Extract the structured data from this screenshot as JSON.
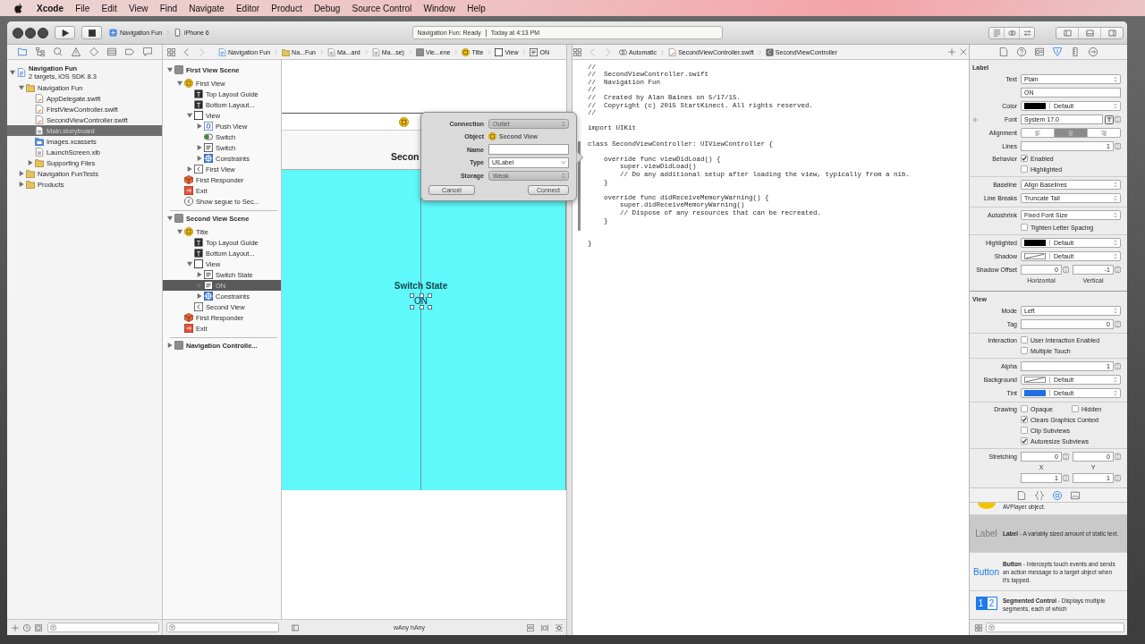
{
  "menu_bar": {
    "app_name": "Xcode",
    "menus": [
      "File",
      "Edit",
      "View",
      "Find",
      "Navigate",
      "Editor",
      "Product",
      "Debug",
      "Source Control",
      "Window",
      "Help"
    ]
  },
  "toolbar": {
    "scheme": "Navigation Fun",
    "device": "iPhone 6",
    "status": "Navigation Fun: Ready",
    "time": "Today at 4:13 PM"
  },
  "navigator": {
    "tabs": [
      {
        "selected": true
      },
      {
        "selected": false
      },
      {
        "selected": false
      },
      {
        "selected": false
      },
      {
        "selected": false
      },
      {
        "selected": false
      },
      {
        "selected": false
      },
      {
        "selected": false
      }
    ],
    "items": [
      {
        "name": "Navigation Fun",
        "subtitle": "2 targets, iOS SDK 8.3",
        "kind": "project",
        "expanded": true,
        "selected": false,
        "children": [
          {
            "name": "Navigation Fun",
            "kind": "folder",
            "expanded": true,
            "selected": false,
            "children": [
              {
                "name": "AppDelegate.swift",
                "kind": "swift",
                "selected": false
              },
              {
                "name": "FirstViewController.swift",
                "kind": "swift",
                "selected": false
              },
              {
                "name": "SecondViewController.swift",
                "kind": "swift",
                "selected": false
              },
              {
                "name": "Main.storyboard",
                "kind": "storyboard",
                "selected": true
              },
              {
                "name": "Images.xcassets",
                "kind": "assets",
                "selected": false
              },
              {
                "name": "LaunchScreen.xib",
                "kind": "xib",
                "selected": false
              },
              {
                "name": "Supporting Files",
                "kind": "folder",
                "expanded": false,
                "selected": false
              }
            ]
          },
          {
            "name": "Navigation FunTests",
            "kind": "folder",
            "expanded": false,
            "selected": false
          },
          {
            "name": "Products",
            "kind": "folder",
            "expanded": false,
            "selected": false
          }
        ]
      }
    ]
  },
  "jump_bar": {
    "crumbs": [
      {
        "label": "Navigation Fun",
        "kind": "project"
      },
      {
        "label": "Na...Fun",
        "kind": "folder"
      },
      {
        "label": "Ma...ard",
        "kind": "storyboard"
      },
      {
        "label": "Ma...se)",
        "kind": "storyboard"
      },
      {
        "label": "Vie...ene",
        "kind": "scene"
      },
      {
        "label": "Title",
        "kind": "controller"
      },
      {
        "label": "View",
        "kind": "view"
      },
      {
        "label": "ON",
        "kind": "label"
      }
    ]
  },
  "outline": {
    "items": [
      {
        "name": "First View Scene",
        "kind": "scene",
        "expanded": true,
        "selected": false,
        "children": [
          {
            "name": "First View",
            "kind": "controller",
            "expanded": true,
            "selected": false,
            "children": [
              {
                "name": "Top Layout Guide",
                "kind": "guide",
                "selected": false
              },
              {
                "name": "Bottom Layout...",
                "kind": "guide",
                "selected": false
              },
              {
                "name": "View",
                "kind": "view",
                "expanded": true,
                "selected": false,
                "children": [
                  {
                    "name": "Push View",
                    "kind": "button",
                    "expanded": false,
                    "selected": false
                  },
                  {
                    "name": "Switch",
                    "kind": "switch",
                    "selected": false
                  },
                  {
                    "name": "Switch",
                    "kind": "label",
                    "expanded": false,
                    "selected": false
                  },
                  {
                    "name": "Constraints",
                    "kind": "constraints",
                    "expanded": false,
                    "selected": false
                  }
                ]
              },
              {
                "name": "First View",
                "kind": "item",
                "expanded": false,
                "selected": false
              }
            ]
          },
          {
            "name": "First Responder",
            "kind": "responder",
            "selected": false
          },
          {
            "name": "Exit",
            "kind": "exit",
            "selected": false
          },
          {
            "name": "Show segue to Sec...",
            "kind": "segue",
            "selected": false
          }
        ]
      },
      {
        "name": "Second View Scene",
        "kind": "scene",
        "expanded": true,
        "selected": false,
        "children": [
          {
            "name": "Title",
            "kind": "controller",
            "expanded": true,
            "selected": false,
            "children": [
              {
                "name": "Top Layout Guide",
                "kind": "guide",
                "selected": false
              },
              {
                "name": "Bottom Layout...",
                "kind": "guide",
                "selected": false
              },
              {
                "name": "View",
                "kind": "view",
                "expanded": true,
                "selected": false,
                "children": [
                  {
                    "name": "Switch State",
                    "kind": "label",
                    "expanded": false,
                    "selected": false
                  },
                  {
                    "name": "ON",
                    "kind": "label",
                    "expanded": false,
                    "selected": true
                  },
                  {
                    "name": "Constraints",
                    "kind": "constraints",
                    "expanded": false,
                    "selected": false
                  }
                ]
              },
              {
                "name": "Second View",
                "kind": "item",
                "selected": false
              }
            ]
          },
          {
            "name": "First Responder",
            "kind": "responder",
            "selected": false
          },
          {
            "name": "Exit",
            "kind": "exit",
            "selected": false
          }
        ]
      },
      {
        "name": "Navigation Controlle...",
        "kind": "scene",
        "expanded": false,
        "selected": false
      }
    ]
  },
  "canvas": {
    "nav_title": "Secon",
    "labels": [
      {
        "text": "Switch State",
        "selected": false
      },
      {
        "text": "ON",
        "selected": true
      }
    ],
    "size_class": "wAny hAny"
  },
  "popover": {
    "fields": [
      {
        "label": "Connection",
        "kind": "popup",
        "value": "Outlet"
      },
      {
        "label": "Object",
        "kind": "object",
        "value": "Second View"
      },
      {
        "label": "Name",
        "kind": "text"
      },
      {
        "label": "Type",
        "kind": "combo",
        "value": "UILabel"
      },
      {
        "label": "Storage",
        "kind": "popup",
        "value": "Weak"
      }
    ],
    "buttons": [
      "Cancel",
      "Connect"
    ]
  },
  "assistant_bar": {
    "crumbs": [
      {
        "label": "Automatic",
        "kind": "automatic"
      },
      {
        "label": "SecondViewController.swift",
        "kind": "swift"
      },
      {
        "label": "SecondViewController",
        "kind": "class"
      }
    ]
  },
  "code": {
    "blocks": [
      [
        "//",
        "//  SecondViewController.swift",
        "//  Navigation Fun",
        "//",
        "//  Created by Alan Baines on 5/17/15.",
        "//  Copyright (c) 2015 StartKinect. All rights reserved.",
        "//"
      ],
      [
        "import UIKit"
      ],
      [
        "class SecondViewController: UIViewController {"
      ],
      [
        "    override func viewDidLoad() {",
        "        super.viewDidLoad()",
        "        // Do any additional setup after loading the view, typically from a nib.",
        "    }"
      ],
      [
        "    override func didReceiveMemoryWarning() {",
        "        super.didReceiveMemoryWarning()",
        "        // Dispose of any resources that can be recreated.",
        "    }"
      ],
      [
        "}"
      ]
    ]
  },
  "inspector": {
    "tabs": [
      {
        "selected": false
      },
      {
        "selected": false
      },
      {
        "selected": false
      },
      {
        "selected": true
      },
      {
        "selected": false
      },
      {
        "selected": false
      }
    ],
    "sections": [
      {
        "title": "Label",
        "groups": [
          [
            {
              "kind": "popup",
              "label": "Text",
              "value": "Plain"
            },
            {
              "kind": "field",
              "value": "ON"
            },
            {
              "kind": "color",
              "label": "Color",
              "color": "#000000",
              "value": "Default"
            },
            {
              "kind": "font",
              "label": "Font",
              "value": "System 17.0"
            },
            {
              "kind": "segmented",
              "label": "Alignment",
              "segments": [
                {
                  "selected": false
                },
                {
                  "selected": true
                },
                {
                  "selected": false
                }
              ]
            },
            {
              "kind": "stepper",
              "label": "Lines",
              "value": "1"
            },
            {
              "kind": "checks",
              "label": "Behavior",
              "lines": [
                [
                  {
                    "label": "Enabled",
                    "checked": true
                  }
                ],
                [
                  {
                    "label": "Highlighted",
                    "checked": false
                  }
                ]
              ]
            }
          ],
          [
            {
              "kind": "popup",
              "label": "Baseline",
              "value": "Align Baselines"
            },
            {
              "kind": "popup",
              "label": "Line Breaks",
              "value": "Truncate Tail"
            }
          ],
          [
            {
              "kind": "popup",
              "label": "Autoshrink",
              "value": "Fixed Font Size"
            },
            {
              "kind": "checks",
              "lines": [
                [
                  {
                    "label": "Tighten Letter Spacing",
                    "checked": false
                  }
                ]
              ]
            }
          ],
          [
            {
              "kind": "color",
              "label": "Highlighted",
              "color": "#000000",
              "value": "Default"
            },
            {
              "kind": "color",
              "label": "Shadow",
              "value": "Default"
            },
            {
              "kind": "pair",
              "label": "Shadow Offset",
              "fields": [
                {
                  "value": "0",
                  "caption": "Horizontal"
                },
                {
                  "value": "-1",
                  "caption": "Vertical"
                }
              ]
            }
          ]
        ]
      },
      {
        "title": "View",
        "groups": [
          [
            {
              "kind": "popup",
              "label": "Mode",
              "value": "Left"
            },
            {
              "kind": "stepper",
              "label": "Tag",
              "value": "0"
            }
          ],
          [
            {
              "kind": "checks",
              "label": "Interaction",
              "lines": [
                [
                  {
                    "label": "User Interaction Enabled",
                    "checked": false
                  }
                ],
                [
                  {
                    "label": "Multiple Touch",
                    "checked": false
                  }
                ]
              ]
            }
          ],
          [
            {
              "kind": "stepper",
              "label": "Alpha",
              "value": "1"
            },
            {
              "kind": "color",
              "label": "Background",
              "value": "Default"
            },
            {
              "kind": "color",
              "label": "Tint",
              "color": "#1e6fe6",
              "value": "Default"
            }
          ],
          [
            {
              "kind": "checks",
              "label": "Drawing",
              "lines": [
                [
                  {
                    "label": "Opaque",
                    "checked": false
                  },
                  {
                    "label": "Hidden",
                    "checked": false
                  }
                ],
                [
                  {
                    "label": "Clears Graphics Context",
                    "checked": true
                  }
                ],
                [
                  {
                    "label": "Clip Subviews",
                    "checked": false
                  }
                ],
                [
                  {
                    "label": "Autoresize Subviews",
                    "checked": true
                  }
                ]
              ]
            }
          ],
          [
            {
              "kind": "pair",
              "label": "Stretching",
              "fields": [
                {
                  "value": "0",
                  "caption": "X"
                },
                {
                  "value": "0",
                  "caption": "Y"
                }
              ]
            },
            {
              "kind": "pair",
              "fields": [
                {
                  "value": "1"
                },
                {
                  "value": "1"
                }
              ]
            }
          ]
        ]
      }
    ]
  },
  "library": {
    "tabs": [
      {
        "selected": false
      },
      {
        "selected": false
      },
      {
        "selected": true
      },
      {
        "selected": false
      }
    ],
    "items": [
      {
        "kind": "avplayer",
        "description": "AVPlayer object.",
        "selected": false
      },
      {
        "kind": "label",
        "preview": "Label",
        "description": "**Label** - A variably sized amount of static text.",
        "selected": true
      },
      {
        "kind": "button",
        "preview": "Button",
        "description": "**Button** - Intercepts touch events and sends an action message to a target object when it's tapped.",
        "selected": false
      },
      {
        "kind": "segmented",
        "preview_segments": [
          "1",
          "2"
        ],
        "description": "**Segmented Control** - Displays multiple segments, each of which",
        "selected": false
      }
    ]
  }
}
